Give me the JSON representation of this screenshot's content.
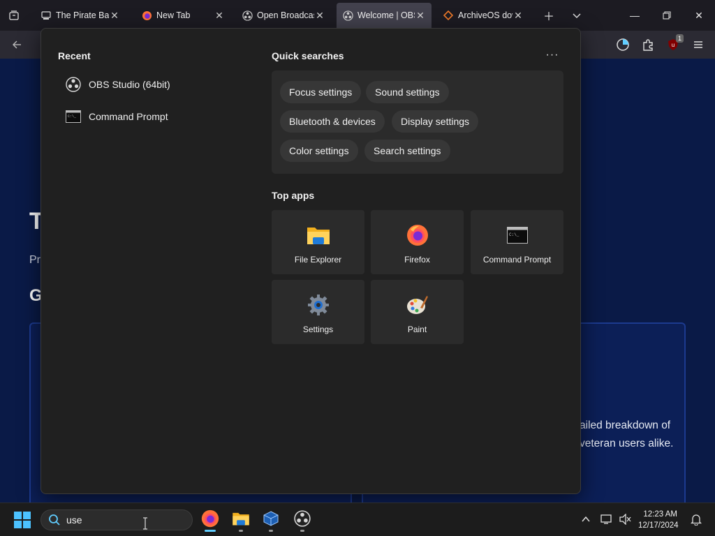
{
  "browser": {
    "tabs": [
      {
        "title": "The Pirate Bay -",
        "icon": "pirate-bay-icon"
      },
      {
        "title": "New Tab",
        "icon": "firefox-icon"
      },
      {
        "title": "Open Broadcast",
        "icon": "obs-icon"
      },
      {
        "title": "Welcome | OBS",
        "icon": "obs-icon",
        "active": true
      },
      {
        "title": "ArchiveOS down",
        "icon": "archiveos-icon"
      }
    ],
    "extensions_badge": "1"
  },
  "page": {
    "heading_initial": "T",
    "subtitle_initial": "Pr",
    "section_initial": "G",
    "card_text_line1": "ailed breakdown of",
    "card_text_line2": "veteran users alike."
  },
  "flyout": {
    "recent_title": "Recent",
    "recent_items": [
      {
        "label": "OBS Studio (64bit)",
        "icon": "obs-icon"
      },
      {
        "label": "Command Prompt",
        "icon": "command-prompt-icon"
      }
    ],
    "quick_searches_title": "Quick searches",
    "more_label": "···",
    "quick_searches": [
      "Focus settings",
      "Sound settings",
      "Bluetooth & devices",
      "Display settings",
      "Color settings",
      "Search settings"
    ],
    "top_apps_title": "Top apps",
    "top_apps": [
      {
        "label": "File Explorer",
        "icon": "file-explorer-icon"
      },
      {
        "label": "Firefox",
        "icon": "firefox-icon"
      },
      {
        "label": "Command Prompt",
        "icon": "command-prompt-icon"
      },
      {
        "label": "Settings",
        "icon": "settings-gear-icon"
      },
      {
        "label": "Paint",
        "icon": "paint-icon"
      }
    ]
  },
  "taskbar": {
    "search_value": "use",
    "time": "12:23 AM",
    "date": "12/17/2024"
  },
  "colors": {
    "accent": "#60cdff",
    "flyout_bg": "#202020",
    "page_bg": "#0a1a47"
  }
}
